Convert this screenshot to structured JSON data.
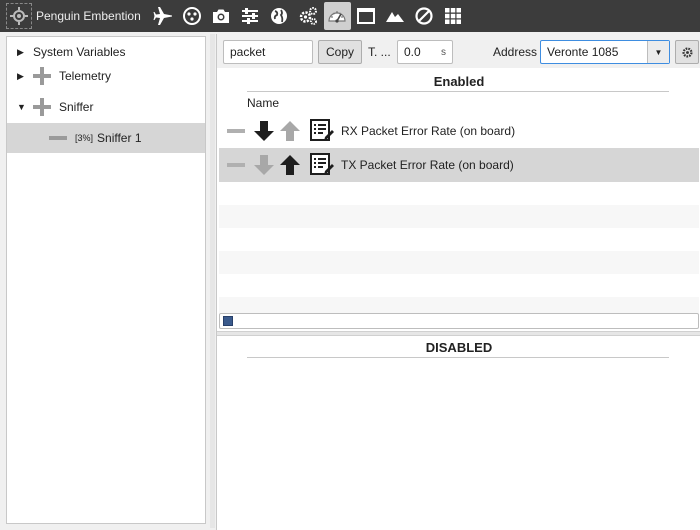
{
  "app": {
    "title": "Penguin Embention"
  },
  "toolbar": {
    "icons": [
      "airplane-icon",
      "joystick-icon",
      "camera-icon",
      "sliders-icon",
      "globe-icon",
      "gears-icon",
      "gauge-icon",
      "window-icon",
      "mountain-icon",
      "prohibited-icon",
      "grid-icon"
    ],
    "active": "gauge-icon"
  },
  "tree": {
    "items": [
      {
        "label": "System Variables",
        "expand": "▶",
        "level": 0
      },
      {
        "label": "Telemetry",
        "expand": "▶",
        "level": 0
      },
      {
        "label": "Sniffer",
        "expand": "▼",
        "level": 0
      },
      {
        "label": "Sniffer 1",
        "percent": "[3%]",
        "level": 1,
        "selected": true
      }
    ]
  },
  "filter": {
    "search_value": "packet",
    "copy_label": "Copy",
    "t_label": "T. ...",
    "time_value": "0.0",
    "time_unit": "s",
    "address_label": "Address",
    "address_value": "Veronte 1085"
  },
  "enabled": {
    "title": "Enabled",
    "column_name": "Name",
    "rows": [
      {
        "label": "RX Packet Error Rate (on board)",
        "direction": "rx"
      },
      {
        "label": "TX Packet Error Rate (on board)",
        "direction": "tx",
        "selected": true
      }
    ]
  },
  "disabled": {
    "title": "DISABLED"
  },
  "colors": {
    "toolbar_bg": "#3c3c3c",
    "selection": "#d6d6d6",
    "accent": "#3e8de0"
  }
}
